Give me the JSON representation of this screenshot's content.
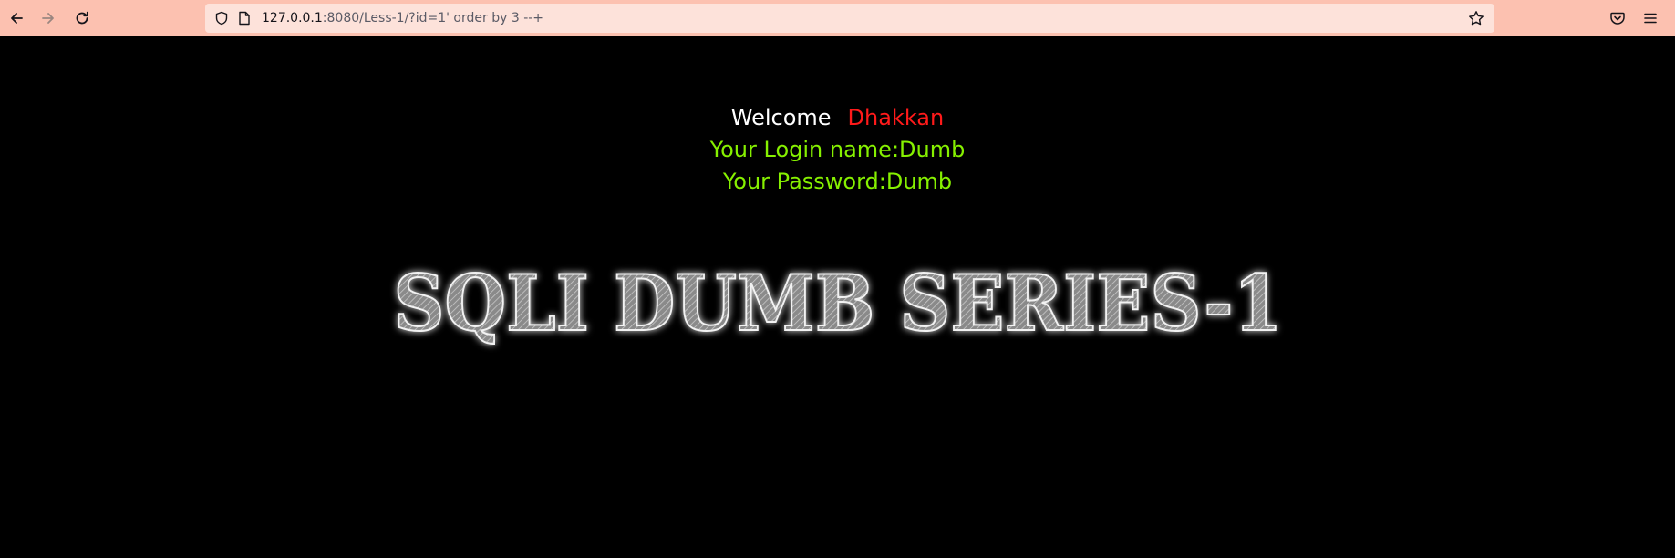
{
  "browser": {
    "back_icon": "arrow-left-icon",
    "forward_icon": "arrow-right-icon",
    "reload_icon": "reload-icon",
    "shield_icon": "shield-icon",
    "page_icon": "page-icon",
    "bookmark_icon": "star-icon",
    "pocket_icon": "pocket-icon",
    "menu_icon": "hamburger-menu-icon",
    "url_host": "127.0.0.1",
    "url_rest": ":8080/Less-1/?id=1' order by 3 --+",
    "toolbar_color": "#fcc1b0",
    "urlbar_color": "#fde2da"
  },
  "page": {
    "welcome_word": "Welcome",
    "welcome_name": "Dhakkan",
    "login_line": "Your Login name:Dumb",
    "password_line": "Your Password:Dumb",
    "banner_text": "SQLI DUMB SERIES-1",
    "colors": {
      "background": "#000000",
      "welcome": "#ffffff",
      "name": "#ff1a1a",
      "credentials": "#86f000"
    }
  }
}
